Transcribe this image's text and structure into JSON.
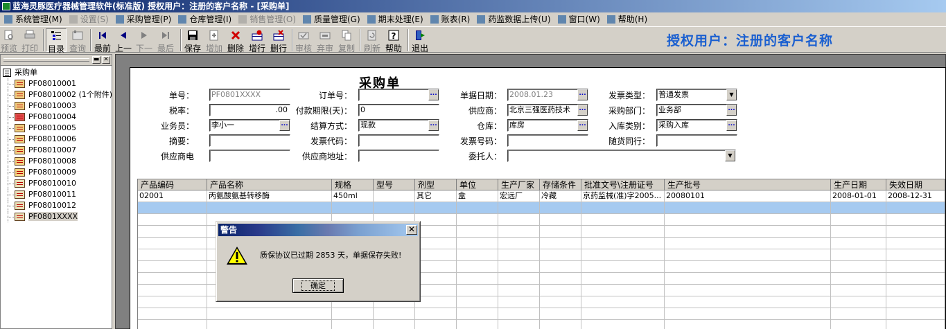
{
  "window": {
    "title": "蓝海灵豚医疗器械管理软件(标准版)   授权用户：注册的客户名称 - [采购单]"
  },
  "menu": [
    {
      "label": "系统管理(M)",
      "enabled": true
    },
    {
      "label": "设置(S)",
      "enabled": false
    },
    {
      "label": "采购管理(P)",
      "enabled": true
    },
    {
      "label": "仓库管理(I)",
      "enabled": true
    },
    {
      "label": "销售管理(O)",
      "enabled": false
    },
    {
      "label": "质量管理(G)",
      "enabled": true
    },
    {
      "label": "期末处理(E)",
      "enabled": true
    },
    {
      "label": "账表(R)",
      "enabled": true
    },
    {
      "label": "药监数据上传(U)",
      "enabled": true
    },
    {
      "label": "窗口(W)",
      "enabled": true
    },
    {
      "label": "帮助(H)",
      "enabled": true
    }
  ],
  "toolbar": {
    "preview": "预览",
    "print": "打印",
    "catalog": "目录",
    "query": "查询",
    "first": "最前",
    "prev": "上一",
    "next": "下一",
    "last": "最后",
    "save": "保存",
    "add": "增加",
    "delete": "删除",
    "add_row": "增行",
    "delete_row": "删行",
    "audit": "审核",
    "abandon": "弃审",
    "copy": "复制",
    "refresh": "刷新",
    "help": "帮助",
    "exit": "退出"
  },
  "license_banner": "授权用户：注册的客户名称",
  "tree": {
    "root": "采购单",
    "items": [
      {
        "label": "PF08010001",
        "icon": "doc"
      },
      {
        "label": "PF08010002 (1个附件)",
        "icon": "doc"
      },
      {
        "label": "PF08010003",
        "icon": "doc"
      },
      {
        "label": "PF08010004",
        "icon": "doc-red"
      },
      {
        "label": "PF08010005",
        "icon": "doc"
      },
      {
        "label": "PF08010006",
        "icon": "doc"
      },
      {
        "label": "PF08010007",
        "icon": "doc"
      },
      {
        "label": "PF08010008",
        "icon": "doc"
      },
      {
        "label": "PF08010009",
        "icon": "doc"
      },
      {
        "label": "PF08010010",
        "icon": "doc-plain"
      },
      {
        "label": "PF08010011",
        "icon": "doc-plain"
      },
      {
        "label": "PF08010012",
        "icon": "doc-plain"
      },
      {
        "label": "PF0801XXXX",
        "icon": "doc-plain"
      }
    ]
  },
  "form": {
    "title": "采购单",
    "labels": {
      "doc_no": "单号：",
      "order_no": "订单号：",
      "doc_date": "单据日期：",
      "invoice_type": "发票类型：",
      "tax_rate": "税率：",
      "pay_term": "付款期限(天)：",
      "supplier": "供应商：",
      "purchase_dept": "采购部门：",
      "salesperson": "业务员：",
      "settle": "结算方式：",
      "warehouse": "仓库：",
      "in_type": "入库类别：",
      "summary": "摘要：",
      "invoice_code": "发票代码：",
      "invoice_no": "发票号码：",
      "accompany": "随货同行：",
      "supplier_phone": "供应商电",
      "supplier_addr": "供应商地址：",
      "consignor": "委托人："
    },
    "values": {
      "doc_no": "PF0801XXXX",
      "order_no": "",
      "doc_date": "2008.01.23",
      "invoice_type": "普通发票",
      "tax_rate": ".00",
      "pay_term": "0",
      "supplier": "北京三强医药技术",
      "purchase_dept": "业务部",
      "salesperson": "李小一",
      "settle": "现款",
      "warehouse": "库房",
      "in_type": "采购入库",
      "summary": "",
      "invoice_code": "",
      "invoice_no": "",
      "accompany": "",
      "supplier_phone": "",
      "supplier_addr": "",
      "consignor": ""
    }
  },
  "grid": {
    "columns": [
      "产品编码",
      "产品名称",
      "规格",
      "型号",
      "剂型",
      "单位",
      "生产厂家",
      "存储条件",
      "批准文号\\注册证号",
      "生产批号",
      "生产日期",
      "失效日期"
    ],
    "rows": [
      [
        "02001",
        "丙氨酸氨基转移酶",
        "450ml",
        "",
        "其它",
        "盒",
        "宏远厂",
        "冷藏",
        "京药监械(准)字2005...",
        "20080101",
        "2008-01-01",
        "2008-12-31"
      ]
    ]
  },
  "dialog": {
    "title": "警告",
    "message": "质保协议已过期 2853 天，单据保存失败!",
    "ok": "确定"
  }
}
